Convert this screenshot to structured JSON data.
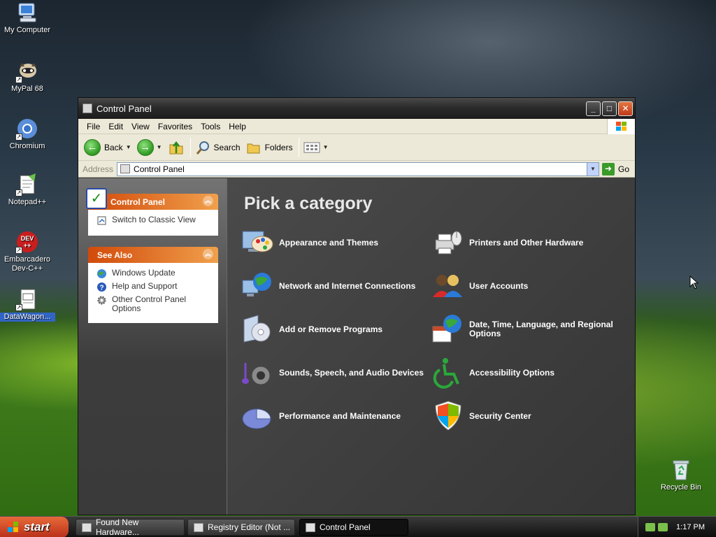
{
  "desktop": {
    "icons": [
      {
        "label": "My Computer"
      },
      {
        "label": "MyPal 68"
      },
      {
        "label": "Chromium"
      },
      {
        "label": "Notepad++"
      },
      {
        "label": "Embarcadero Dev-C++"
      },
      {
        "label": "DataWagon..."
      },
      {
        "label": "Recycle Bin"
      }
    ]
  },
  "window": {
    "title": "Control Panel",
    "menu": [
      "File",
      "Edit",
      "View",
      "Favorites",
      "Tools",
      "Help"
    ],
    "toolbar": {
      "back": "Back",
      "search": "Search",
      "folders": "Folders"
    },
    "address": {
      "label": "Address",
      "value": "Control Panel",
      "go": "Go"
    },
    "sidebar": {
      "control_panel": {
        "title": "Control Panel",
        "items": [
          "Switch to Classic View"
        ]
      },
      "see_also": {
        "title": "See Also",
        "items": [
          "Windows Update",
          "Help and Support",
          "Other Control Panel Options"
        ]
      }
    },
    "main": {
      "heading": "Pick a category",
      "categories": [
        "Appearance and Themes",
        "Printers and Other Hardware",
        "Network and Internet Connections",
        "User Accounts",
        "Add or Remove Programs",
        "Date, Time, Language, and Regional Options",
        "Sounds, Speech, and Audio Devices",
        "Accessibility Options",
        "Performance and Maintenance",
        "Security Center"
      ]
    }
  },
  "taskbar": {
    "start": "start",
    "tasks": [
      "Found New Hardware...",
      "Registry Editor (Not ...",
      "Control Panel"
    ],
    "clock": "1:17 PM"
  },
  "colors": {
    "panel_header": "#e0651e",
    "window_chrome": "#2b2b2b",
    "menu_bg": "#ece9d8",
    "content_bg": "#3f3f3f"
  }
}
